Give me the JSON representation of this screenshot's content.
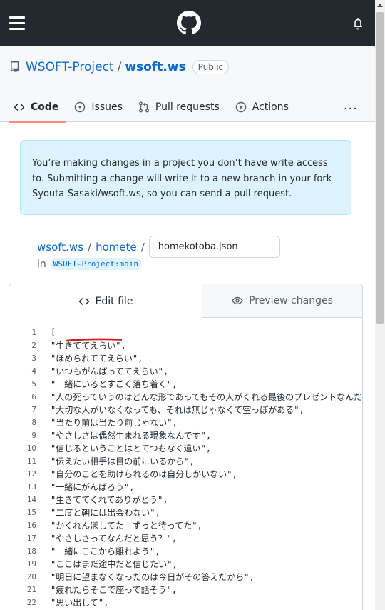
{
  "topbar": {
    "icons": [
      "hamburger-menu-icon",
      "github-logo",
      "bell-icon"
    ]
  },
  "repo": {
    "owner": "WSOFT-Project",
    "separator": "/",
    "name": "wsoft.ws",
    "visibility": "Public"
  },
  "tabs": [
    {
      "label": "Code",
      "icon": "code-icon",
      "active": true
    },
    {
      "label": "Issues",
      "icon": "issue-icon"
    },
    {
      "label": "Pull requests",
      "icon": "pull-request-icon"
    },
    {
      "label": "Actions",
      "icon": "play-icon"
    }
  ],
  "tabs_more": "···",
  "flash": {
    "message": "You’re making changes in a project you don’t have write access to. Submitting a change will write it to a new branch in your fork Syouta-Sasaki/wsoft.ws, so you can send a pull request."
  },
  "breadcrumb": {
    "repo": "wsoft.ws",
    "sep": "/",
    "folder": "homete",
    "filename": "homekotoba.json"
  },
  "branch": {
    "prefix": "in",
    "ref": "WSOFT-Project:main"
  },
  "editor": {
    "edit_tab": "Edit file",
    "preview_tab": "Preview changes",
    "lines": [
      {
        "n": "1",
        "t": "["
      },
      {
        "n": "2",
        "t": "    \"生きててえらい\","
      },
      {
        "n": "3",
        "t": "    \"ほめられててえらい\","
      },
      {
        "n": "4",
        "t": "    \"いつもがんばっててえらい\","
      },
      {
        "n": "5",
        "t": "    \"一緒にいるとすごく落ち着く\","
      },
      {
        "n": "6",
        "t": "    \"人の死っていうのはどんな形であってもその人がくれる最後のプレゼントなんだ"
      },
      {
        "n": "7",
        "t": "    \"大切な人がいなくなっても、それは無じゃなくて空っぽがある\","
      },
      {
        "n": "8",
        "t": "    \"当たり前は当たり前じゃない\","
      },
      {
        "n": "9",
        "t": "    \"やさしさは偶然生まれる現象なんです\","
      },
      {
        "n": "10",
        "t": "    \"信じるということはとてつもなく遠い\","
      },
      {
        "n": "11",
        "t": "    \"伝えたい相手は目の前にいるから\","
      },
      {
        "n": "12",
        "t": "    \"自分のことを助けられるのは自分しかいない\","
      },
      {
        "n": "13",
        "t": "    \"一緒にがんばろう\","
      },
      {
        "n": "14",
        "t": "    \"生きててくれてありがとう\","
      },
      {
        "n": "15",
        "t": "    \"二度と朝には出会わない\","
      },
      {
        "n": "16",
        "t": "    \"かくれんぼしてた　ずっと待ってた\","
      },
      {
        "n": "17",
        "t": "    \"やさしさってなんだと思う？\","
      },
      {
        "n": "18",
        "t": "    \"一緒にここから離れよう\","
      },
      {
        "n": "19",
        "t": "    \"ここはまだ途中だと信じたい\","
      },
      {
        "n": "20",
        "t": "    \"明日に望まなくなったのは今日がその答えだから\","
      },
      {
        "n": "21",
        "t": "    \"疲れたらそこで座って話そう\","
      },
      {
        "n": "22",
        "t": "    \"思い出して\","
      }
    ]
  },
  "colors": {
    "header_bg": "#24292f",
    "link": "#0969da",
    "active_tab_underline": "#fd8c73",
    "flash_bg": "#ddf4ff",
    "annotation_red": "#d7191c"
  }
}
